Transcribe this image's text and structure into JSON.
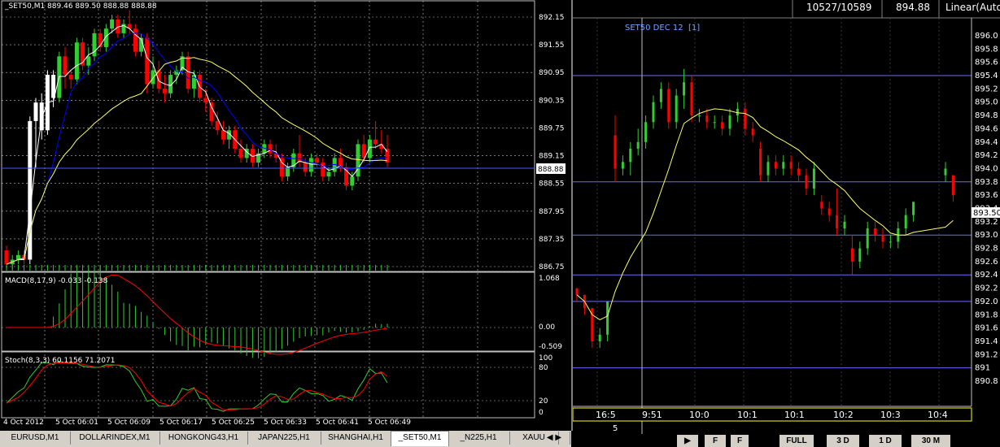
{
  "left_chart": {
    "symbol_info": "_SET50,M1  889.46 889.50 888.88 888.88",
    "price_ticks": [
      "892.15",
      "891.55",
      "890.95",
      "890.35",
      "889.75",
      "889.15",
      "888.55",
      "887.95",
      "887.35",
      "886.75"
    ],
    "current_price": "888.88",
    "macd_label": "MACD(8,17,9) -0.033 -0.138",
    "macd_ticks": [
      "1.068",
      "0.00",
      "-0.509"
    ],
    "stoch_label": "Stoch(8,3,3) 60.1156 71.2071",
    "stoch_ticks": [
      "100",
      "80",
      "20",
      "0"
    ],
    "time_labels": [
      "4 Oct 2012",
      "5 Oct 06:01",
      "5 Oct 06:09",
      "5 Oct 06:17",
      "5 Oct 06:25",
      "5 Oct 06:33",
      "5 Oct 06:41",
      "5 Oct 06:49"
    ],
    "colors": {
      "up": "#32cd32",
      "down": "#ff0000",
      "white": "#ffffff",
      "ma_blue": "#0000ff",
      "ma_yellow": "#ffff66",
      "grid": "#c0c0c0"
    },
    "candles": [
      [
        887.1,
        887.2,
        886.7,
        886.8
      ],
      [
        886.8,
        887.0,
        886.7,
        886.9
      ],
      [
        886.9,
        887.1,
        886.8,
        887.0
      ],
      [
        887.0,
        887.1,
        886.8,
        886.9
      ],
      [
        886.9,
        890.0,
        886.8,
        889.9
      ],
      [
        889.9,
        890.4,
        888.9,
        890.3
      ],
      [
        890.3,
        890.5,
        889.5,
        889.7
      ],
      [
        889.7,
        891.0,
        889.6,
        890.9
      ],
      [
        890.9,
        891.0,
        890.2,
        890.4
      ],
      [
        890.4,
        891.4,
        890.3,
        891.3
      ],
      [
        891.3,
        891.5,
        890.6,
        890.9
      ],
      [
        890.9,
        891.0,
        890.6,
        890.8
      ],
      [
        890.8,
        891.7,
        890.7,
        891.6
      ],
      [
        891.6,
        891.7,
        891.0,
        891.1
      ],
      [
        891.1,
        891.5,
        890.9,
        891.3
      ],
      [
        891.3,
        891.9,
        891.2,
        891.8
      ],
      [
        891.8,
        891.9,
        891.4,
        891.5
      ],
      [
        891.5,
        892.0,
        891.4,
        891.9
      ],
      [
        891.9,
        892.2,
        891.8,
        892.1
      ],
      [
        892.1,
        892.2,
        891.7,
        891.8
      ],
      [
        891.8,
        892.1,
        891.7,
        892.0
      ],
      [
        892.0,
        892.3,
        891.8,
        891.9
      ],
      [
        891.9,
        892.0,
        891.3,
        891.4
      ],
      [
        891.4,
        891.8,
        891.3,
        891.7
      ],
      [
        891.7,
        891.8,
        890.5,
        890.7
      ],
      [
        890.7,
        891.3,
        890.6,
        891.0
      ],
      [
        891.0,
        891.2,
        890.5,
        890.6
      ],
      [
        890.6,
        890.9,
        890.3,
        890.5
      ],
      [
        890.5,
        891.0,
        890.4,
        890.9
      ],
      [
        890.9,
        891.1,
        890.7,
        891.0
      ],
      [
        891.0,
        891.4,
        890.9,
        891.3
      ],
      [
        891.3,
        891.4,
        890.5,
        890.6
      ],
      [
        890.6,
        891.0,
        890.4,
        890.9
      ],
      [
        890.9,
        891.0,
        890.3,
        890.4
      ],
      [
        890.4,
        890.6,
        890.1,
        890.3
      ],
      [
        890.3,
        890.4,
        889.8,
        889.9
      ],
      [
        889.9,
        890.1,
        889.6,
        889.7
      ],
      [
        889.7,
        889.9,
        889.4,
        889.5
      ],
      [
        889.5,
        889.8,
        889.3,
        889.7
      ],
      [
        889.7,
        889.8,
        889.2,
        889.3
      ],
      [
        889.3,
        889.5,
        889.0,
        889.1
      ],
      [
        889.1,
        889.4,
        889.0,
        889.3
      ],
      [
        889.3,
        889.4,
        888.9,
        889.0
      ],
      [
        889.0,
        889.3,
        888.9,
        889.2
      ],
      [
        889.2,
        889.5,
        889.1,
        889.4
      ],
      [
        889.4,
        889.5,
        889.1,
        889.2
      ],
      [
        889.2,
        889.4,
        889.0,
        889.1
      ],
      [
        889.1,
        889.2,
        888.6,
        888.7
      ],
      [
        888.7,
        889.0,
        888.6,
        888.9
      ],
      [
        888.9,
        889.3,
        888.8,
        889.2
      ],
      [
        889.2,
        889.6,
        888.9,
        889.0
      ],
      [
        889.0,
        889.1,
        888.7,
        888.8
      ],
      [
        888.8,
        889.2,
        888.7,
        889.1
      ],
      [
        889.1,
        889.2,
        888.9,
        889.0
      ],
      [
        889.0,
        889.1,
        888.6,
        888.7
      ],
      [
        888.7,
        888.9,
        888.6,
        888.8
      ],
      [
        888.8,
        889.2,
        888.7,
        889.1
      ],
      [
        889.1,
        889.3,
        888.8,
        888.9
      ],
      [
        888.9,
        889.0,
        888.4,
        888.5
      ],
      [
        888.5,
        888.8,
        888.4,
        888.7
      ],
      [
        888.7,
        889.5,
        888.6,
        889.4
      ],
      [
        889.4,
        889.6,
        889.0,
        889.1
      ],
      [
        889.1,
        889.6,
        889.0,
        889.5
      ],
      [
        889.5,
        889.9,
        889.3,
        889.4
      ],
      [
        889.4,
        889.7,
        889.2,
        889.3
      ],
      [
        889.3,
        889.6,
        888.9,
        889.0
      ]
    ]
  },
  "right_chart": {
    "header_counts": "10527/10589",
    "header_price": "894.88",
    "header_mode": "Linear(Auto",
    "symbol_label": "SET50 DEC 12",
    "bracket": "[1]",
    "price_ticks": [
      "896.0",
      "895.8",
      "895.6",
      "895.4",
      "895.2",
      "895.0",
      "894.8",
      "894.6",
      "894.4",
      "894.2",
      "894.0",
      "893.8",
      "893.6",
      "893.4",
      "893.2",
      "893.0",
      "892.8",
      "892.6",
      "892.4",
      "892.2",
      "892.0",
      "891.8",
      "891.6",
      "891.4",
      "891.2",
      "891",
      "890.8"
    ],
    "current_price": "893.50",
    "time_labels": [
      "16:5",
      "9:51",
      "10:0",
      "10:1",
      "10:1",
      "10:2",
      "10:3",
      "10:4"
    ],
    "bottom_number": "5",
    "buttons": [
      "",
      "F",
      "F",
      "FULL",
      "3 D",
      "1 D",
      "30 M"
    ],
    "candles": [
      [
        892.2,
        892.2,
        892.0,
        892.1
      ],
      [
        892.1,
        892.1,
        891.8,
        891.9
      ],
      [
        891.9,
        891.9,
        891.3,
        891.4
      ],
      [
        891.4,
        891.6,
        891.3,
        891.5
      ],
      [
        891.5,
        892.0,
        891.4,
        892.0
      ],
      [
        894.5,
        894.8,
        893.8,
        894.0
      ],
      [
        894.0,
        894.2,
        893.9,
        894.1
      ],
      [
        894.1,
        894.4,
        893.9,
        894.3
      ],
      [
        894.3,
        894.6,
        894.2,
        894.4
      ],
      [
        894.4,
        894.8,
        894.3,
        894.7
      ],
      [
        894.7,
        895.1,
        894.6,
        895.0
      ],
      [
        895.0,
        895.3,
        894.9,
        895.2
      ],
      [
        895.2,
        895.3,
        894.6,
        894.7
      ],
      [
        894.7,
        895.2,
        894.6,
        895.1
      ],
      [
        895.1,
        895.5,
        894.9,
        895.3
      ],
      [
        895.3,
        895.4,
        894.7,
        894.8
      ],
      [
        894.8,
        894.9,
        894.7,
        894.8
      ],
      [
        894.8,
        894.9,
        894.6,
        894.7
      ],
      [
        894.7,
        894.8,
        894.6,
        894.7
      ],
      [
        894.7,
        894.8,
        894.5,
        894.6
      ],
      [
        894.6,
        894.9,
        894.5,
        894.8
      ],
      [
        894.8,
        895.0,
        894.7,
        894.9
      ],
      [
        894.9,
        895.0,
        894.5,
        894.6
      ],
      [
        894.6,
        894.7,
        894.4,
        894.5
      ],
      [
        894.3,
        894.4,
        893.8,
        893.9
      ],
      [
        893.9,
        894.2,
        893.8,
        894.1
      ],
      [
        894.1,
        894.2,
        893.9,
        894.0
      ],
      [
        894.0,
        894.2,
        893.9,
        894.1
      ],
      [
        894.1,
        894.2,
        893.9,
        894.0
      ],
      [
        894.0,
        894.1,
        893.8,
        893.9
      ],
      [
        893.9,
        894.0,
        893.6,
        893.7
      ],
      [
        893.7,
        894.1,
        893.6,
        894.0
      ],
      [
        893.5,
        893.6,
        893.3,
        893.4
      ],
      [
        893.4,
        893.5,
        893.2,
        893.3
      ],
      [
        893.3,
        893.7,
        893.0,
        893.1
      ],
      [
        893.1,
        893.3,
        893.0,
        893.2
      ],
      [
        892.8,
        893.0,
        892.4,
        892.6
      ],
      [
        892.6,
        892.9,
        892.5,
        892.8
      ],
      [
        892.8,
        893.2,
        892.7,
        893.1
      ],
      [
        893.1,
        893.2,
        892.9,
        893.0
      ],
      [
        893.0,
        893.1,
        892.8,
        892.9
      ],
      [
        892.9,
        893.0,
        892.8,
        892.9
      ],
      [
        892.9,
        893.2,
        892.8,
        893.1
      ],
      [
        893.1,
        893.4,
        893.0,
        893.3
      ],
      [
        893.3,
        893.5,
        893.2,
        893.5
      ],
      [
        893.9,
        894.1,
        893.8,
        894.0
      ],
      [
        893.9,
        893.9,
        893.5,
        893.6
      ]
    ]
  },
  "tabs": [
    "EURUSD,M1",
    "DOLLARINDEX,M1",
    "HONGKONG43,H1",
    "JAPAN225,H1",
    "SHANGHAI,H1",
    "_SET50,M1",
    "_N225,H1",
    "XAUU"
  ],
  "active_tab": 5
}
